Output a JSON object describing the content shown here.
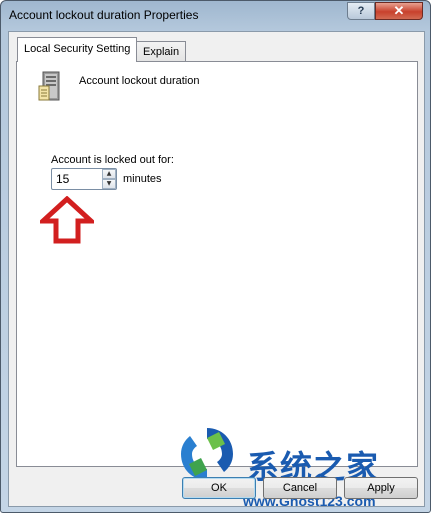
{
  "window": {
    "title": "Account lockout duration Properties",
    "help_glyph": "?",
    "close_glyph": "✕"
  },
  "tabs": [
    {
      "label": "Local Security Setting",
      "active": true
    },
    {
      "label": "Explain",
      "active": false
    }
  ],
  "policy": {
    "icon": "server-icon",
    "title": "Account lockout duration"
  },
  "setting": {
    "label": "Account is locked out for:",
    "value": "15",
    "unit": "minutes",
    "up_glyph": "▲",
    "down_glyph": "▼"
  },
  "annotation": {
    "icon": "red-up-arrow-icon",
    "color": "#d21f1f"
  },
  "watermark": {
    "text_cn": "系统之家",
    "url": "www.Ghost123.com",
    "color": "#1a5bb0"
  },
  "buttons": {
    "ok": "OK",
    "cancel": "Cancel",
    "apply": "Apply"
  }
}
